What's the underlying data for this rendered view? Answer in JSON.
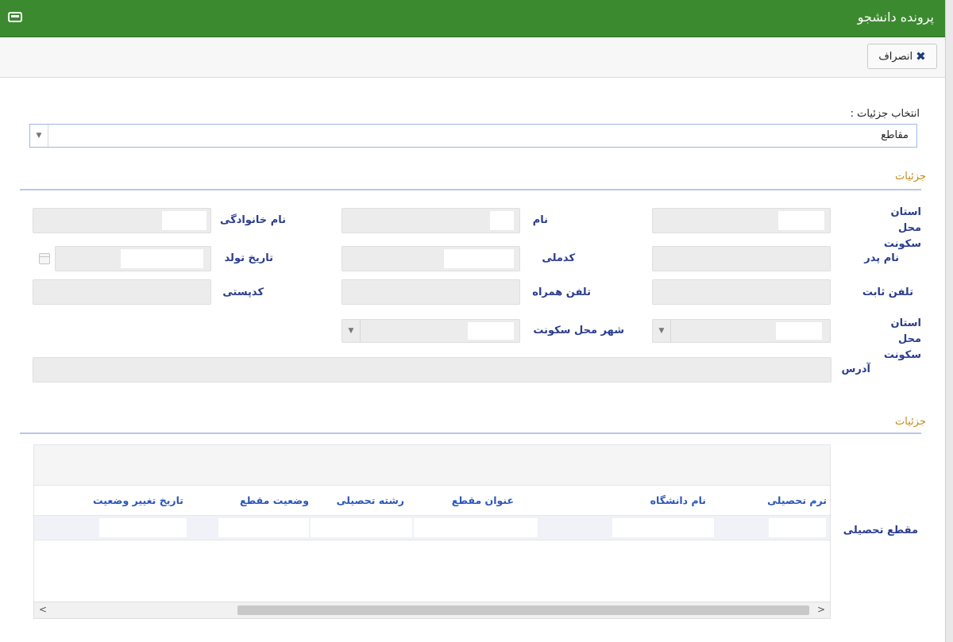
{
  "window": {
    "title": "پرونده دانشجو"
  },
  "toolbar": {
    "cancel_label": "انصراف"
  },
  "details_select": {
    "label": "انتخاب جزئیات :",
    "value": "مقاطع"
  },
  "section1": {
    "title": "جزئیات"
  },
  "form": {
    "province_label": "استان محل سکونت",
    "first_name_label": "نام",
    "last_name_label": "نام خانوادگی",
    "father_name_label": "نام پدر",
    "national_code_label": "کدملی",
    "birth_date_label": "تاریخ تولد",
    "landline_label": "تلفن ثابت",
    "mobile_label": "تلفن همراه",
    "postal_code_label": "کدپستی",
    "province2_label": "استان محل سکونت",
    "city_label": "شهر محل سکونت",
    "address_label": "آدرس"
  },
  "section2": {
    "title": "جزئیات"
  },
  "grid": {
    "row_label": "مقطع تحصیلی",
    "columns": [
      "ترم تحصیلی",
      "نام دانشگاه",
      "عنوان مقطع",
      "رشته تحصیلی",
      "وضعیت مقطع",
      "تاریخ تغییر وضعیت"
    ]
  },
  "scrollbar": {
    "left_arrow": "<",
    "right_arrow": ">"
  },
  "icons": [
    "window-icon",
    "close-x-icon",
    "dropdown-arrow-icon",
    "calendar-icon"
  ]
}
